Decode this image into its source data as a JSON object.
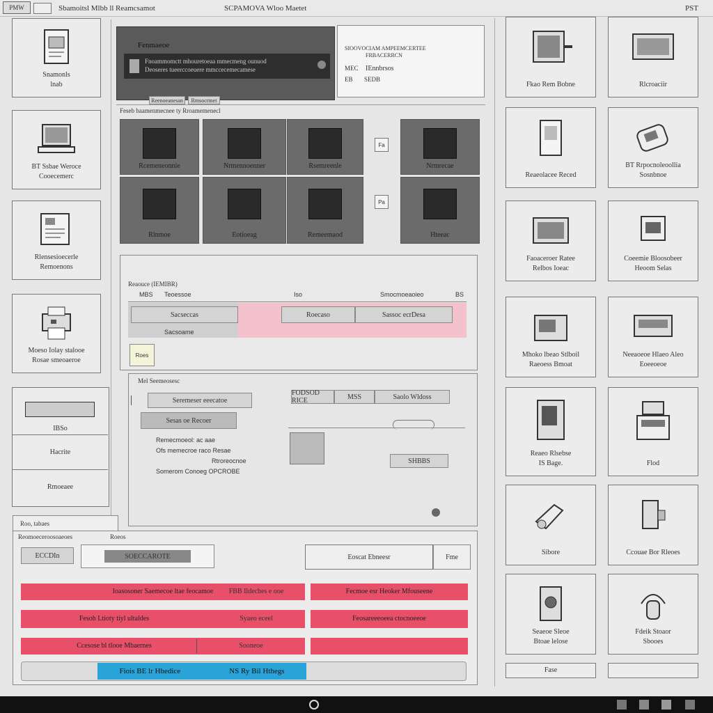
{
  "topbar": {
    "logo": "PMW",
    "title1": "Sbamoitsl Mlbb ll",
    "title2": "Reamcsamot",
    "center_title": "SCPAMOVA Wloo Maetet",
    "corner": "PST"
  },
  "left_cards": [
    {
      "label": "Snamonls\nlnab"
    },
    {
      "label": "BT Ssbae Weroce\nCooecemerc"
    },
    {
      "label": "Rlensesioecerle\nRemoenons"
    },
    {
      "label": "Moeso Iolay stalooe\nRosae smeoaeroe"
    }
  ],
  "left_stack": {
    "device_label": "IBSo",
    "item2": "Hacrite",
    "item3": "Rmoeaee"
  },
  "hero": {
    "title": "Fenmaeoe",
    "line1": "Fnoammomctt mhouretoeaa mmecmeng ounuod",
    "line2": "Deoseres tueerccoeuere mmccecemecamese",
    "btn1": "Reenoeanesan",
    "btn2": "Rmsocrmet"
  },
  "info_box": {
    "line1": "SIOOVOCIAM AMPEEMCERTEE",
    "line2": "FRBACERRCN",
    "line3": "IEnnbrsos",
    "line4": "SEDB",
    "n1": "MEC",
    "n2": "EB"
  },
  "section_caption": "Feseb baamenmecnee ty Rroamemenecl",
  "tiles": [
    {
      "label": "Rcemeneonnie"
    },
    {
      "label": "Nrmennoenner"
    },
    {
      "label": "Rsemreenle"
    },
    {
      "label": "Nrmrecae"
    },
    {
      "label": "Rlnmoe"
    },
    {
      "label": "Eotioeag"
    },
    {
      "label": "Remeemaod"
    },
    {
      "label": "Hteeac"
    }
  ],
  "small_icons": [
    "Fa",
    "Pa"
  ],
  "panel1": {
    "title": "Reaouce (IEMIBR)",
    "col1": "MBS",
    "col2": "Teoessoe",
    "col3": "Iso",
    "col4": "Smocmoeaoieo",
    "col5": "BS",
    "row1_btn": "Sacseccas",
    "row1_btn2": "Roecaso",
    "row1_btn3": "Sassoc ecrDesa",
    "row2_text": "Sacsoame",
    "tag": "Roes"
  },
  "panel2": {
    "title": "Mel Seemeosesc",
    "f1": "Seremeser eeecatoe",
    "f2": "Sesas oe Recoer",
    "r1": "Remecmoeol: ac aae",
    "r2": "Ofs memecroe raco Resae",
    "r3": "Rtroreocnoe",
    "r4": "Somerom Conoeg OPCROBE",
    "s1": "FODSOD RICE",
    "s2": "MSS",
    "s3": "Saolo Wldoss",
    "s4": "SHBBS"
  },
  "bottom": {
    "tab1": "Roo, tabaes",
    "caption1": "Reomoeceroosoaeoes",
    "caption2": "Roeos",
    "ctrl1": "ECCDIn",
    "ctrl2": "SOECCAROTE",
    "input_label": "Eoscat Ebneesr",
    "input_btn": "Fme",
    "red_rows": [
      {
        "left": "Ioasosoner Saemecoe ltae feocamoe",
        "right": "FBB Ildecbes e ooe",
        "far": "Fecmoe esr Heoker Mfouseene"
      },
      {
        "left": "Fesoh Ltioty tiyl ultaldes",
        "right": "Syaeo eceel",
        "far": "Feosareeeoeea ctocnoeeoe"
      },
      {
        "left": "Ccesose bl tlooe Mbaernes",
        "right": "Sooneoe",
        "far": ""
      }
    ],
    "blue_btn": "Fiois BE lr Hhedice",
    "blue_btn2": "NS  Ry Bil Hthegs"
  },
  "right_cards": [
    {
      "label": "Fkao Rem Bobne"
    },
    {
      "label": "Rlcroaciir"
    },
    {
      "label": "Reaeolacee Reced"
    },
    {
      "label": "BT Rrpocnoleoollia\nSosnbnoe"
    },
    {
      "label": "Faoaceroer Ratee\nRelbos Ioeac"
    },
    {
      "label": "Coeemie Bloosobeer\nHeoom Selas"
    },
    {
      "label": "Mhoko lbeao Stlboil\nRaeoess Bmoat"
    },
    {
      "label": "Neeaoeoe Hlaeo Aleo\nEoeeoeoe"
    },
    {
      "label": "Reaeo Rlsebse\nIS Bage."
    },
    {
      "label": "Flod"
    },
    {
      "label": "Sibore"
    },
    {
      "label": "Ccouae Bor Rleoes"
    },
    {
      "label": "Seaeoe Sleoe\nBtoae lelose"
    },
    {
      "label": "Fdeik Stoaor\nSbooes"
    }
  ],
  "right_bottom": {
    "label": "Fase"
  },
  "colors": {
    "accent_red": "#e8506a",
    "accent_blue": "#2aa4d8",
    "tile_bg": "#6b6b6b"
  },
  "taskbar": {
    "icons": [
      "circle-icon",
      "app-icon-1",
      "app-icon-2",
      "app-icon-3",
      "app-icon-4"
    ]
  }
}
